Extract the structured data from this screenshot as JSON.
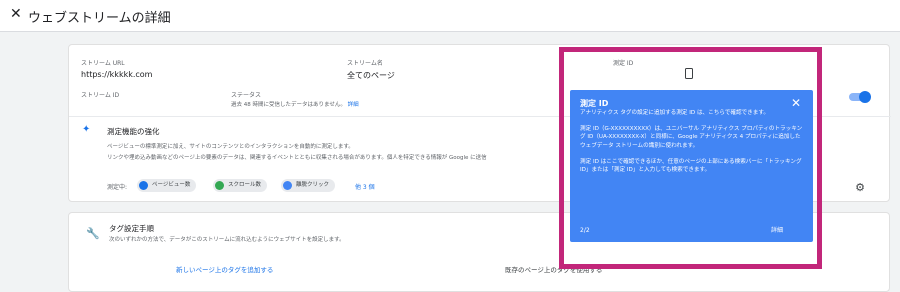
{
  "header": {
    "close_glyph": "✕",
    "title": "ウェブストリームの詳細"
  },
  "stream": {
    "url_label": "ストリーム URL",
    "url_value": "https://kkkkk.com",
    "name_label": "ストリーム名",
    "name_value": "全てのページ",
    "measurement_id_label": "測定 ID",
    "stream_id_label": "ストリーム ID",
    "status_label": "ステータス",
    "status_value": "過去 48 時間に受信したデータはありません。",
    "status_link": "詳細"
  },
  "enhanced": {
    "title": "測定機能の強化",
    "desc1": "ページビューの標準測定に加え、サイトのコンテンツとのインタラクションを自動的に測定します。",
    "desc2": "リンクや埋め込み動画などのページ上の要素のデータは、関連するイベントとともに収集される場合があります。個人を特定できる情報が Google に送信",
    "measuring_label": "測定中:",
    "chips": [
      "ページビュー数",
      "スクロール数",
      "離脱クリック"
    ],
    "more_link": "他 3 個",
    "toggle_on": true
  },
  "tag_setup": {
    "title": "タグ設定手順",
    "desc": "次のいずれかの方法で、データがこのストリームに流れ込むようにウェブサイトを設定します。",
    "option_new": "新しいページ上のタグを追加する",
    "option_existing": "既存のページ上のタグを使用する"
  },
  "popup": {
    "title": "測定 ID",
    "p1": "アナリティクス タグの設定に追加する測定 ID は、こちらで確認できます。",
    "p2": "測定 ID（G-XXXXXXXXXX）は、ユニバーサル アナリティクス プロパティのトラッキング ID（UA-XXXXXXXX-X）と同様に、Google アナリティクス 4 プロパティに追加したウェブデータ ストリームの識別に使われます。",
    "p3": "測定 ID はここで確認できるほか、任意のページの上部にある検索バーに「トラッキング ID」または「測定 ID」と入力しても検索できます。",
    "step": "2/2",
    "more": "詳細",
    "close_glyph": "✕"
  },
  "colors": {
    "accent": "#1a73e8",
    "popup_bg": "#4285f4",
    "highlight": "#c2267a"
  }
}
